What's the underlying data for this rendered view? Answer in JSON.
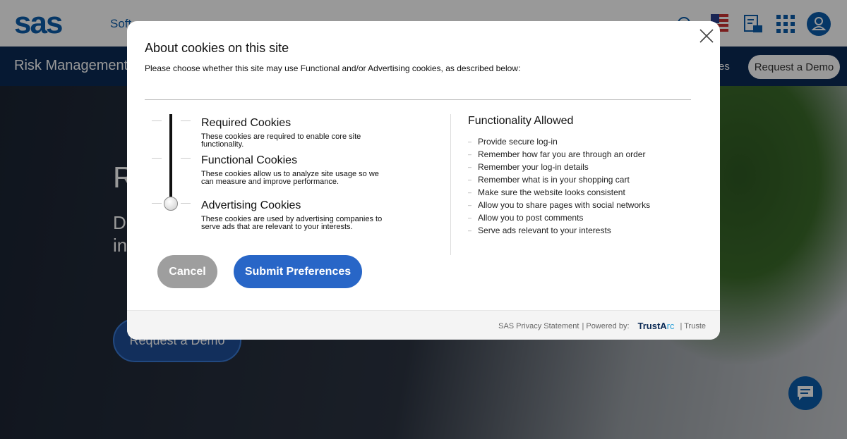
{
  "background": {
    "logo": "sas",
    "nav_fragment": "Soft",
    "subnav_title": "Risk Management",
    "subnav_fragment": "es",
    "request_demo_top": "Request a Demo",
    "hero_title_fragment": "R",
    "hero_desc_fragments": [
      "D",
      "in"
    ],
    "request_demo_hero": "Request a Demo",
    "icons": [
      "search-icon",
      "us-flag-icon",
      "document-mail-icon",
      "apps-grid-icon",
      "user-avatar-icon",
      "chat-icon"
    ]
  },
  "modal": {
    "title": "About cookies on this site",
    "description": "Please choose whether this site may use Functional and/or Advertising cookies, as described below:",
    "slider_level": "Advertising Cookies",
    "categories": [
      {
        "name": "Required Cookies",
        "desc": "These cookies are required to enable core site functionality."
      },
      {
        "name": "Functional Cookies",
        "desc": "These cookies allow us to analyze site usage so we can measure and improve performance."
      },
      {
        "name": "Advertising Cookies",
        "desc": "These cookies are used by advertising companies to serve ads that are relevant to your interests."
      }
    ],
    "allowed_title": "Functionality Allowed",
    "allowed": [
      "Provide secure log-in",
      "Remember how far you are through an order",
      "Remember your log-in details",
      "Remember what is in your shopping cart",
      "Make sure the website looks consistent",
      "Allow you to share pages with social networks",
      "Allow you to post comments",
      "Serve ads relevant to your interests"
    ],
    "cancel": "Cancel",
    "submit": "Submit Preferences",
    "footer": {
      "privacy": "SAS Privacy Statement",
      "powered": "| Powered by:",
      "brand_a": "TrustA",
      "brand_b": "rc",
      "truste": "| Truste"
    }
  },
  "colors": {
    "brand": "#0b5cab",
    "navy": "#0b2a55",
    "submit": "#2866c7",
    "cancel": "#9e9e9e"
  }
}
